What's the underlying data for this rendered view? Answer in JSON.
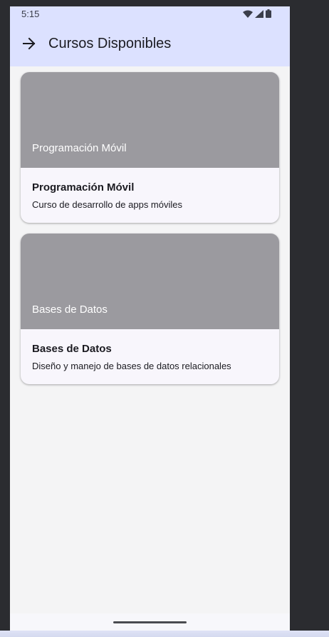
{
  "status_bar": {
    "time": "5:15",
    "icons": [
      "wifi-icon",
      "cell-signal-icon",
      "battery-icon"
    ]
  },
  "app_bar": {
    "title": "Cursos Disponibles",
    "nav_icon": "arrow-forward-icon"
  },
  "courses": [
    {
      "image_label": "Programación Móvil",
      "title": "Programación Móvil",
      "description": "Curso de desarrollo de apps móviles"
    },
    {
      "image_label": "Bases de Datos",
      "title": "Bases de Datos",
      "description": "Diseño y manejo de bases de datos relacionales"
    }
  ],
  "colors": {
    "app_bar_background": "#dce1ff",
    "screen_background": "#f4f4f5",
    "card_background": "#f8f6fc",
    "image_placeholder": "#9b9a9f",
    "text_primary": "#1b1b21"
  }
}
